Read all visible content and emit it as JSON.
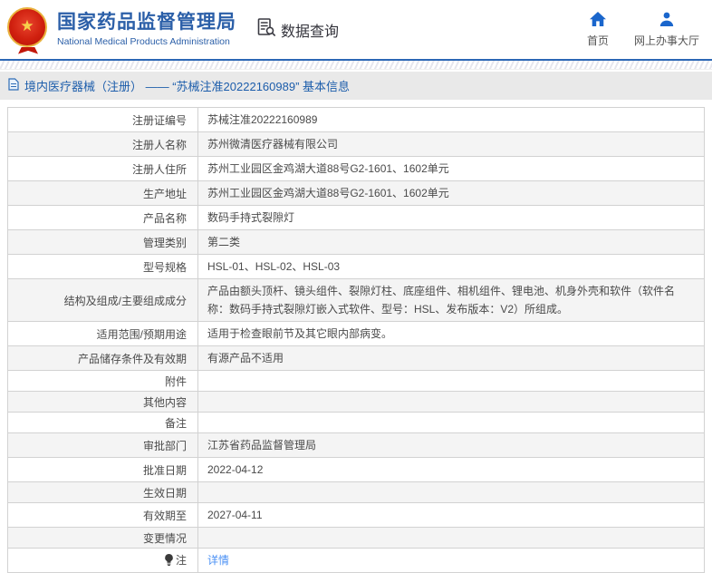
{
  "header": {
    "org_name_zh": "国家药品监督管理局",
    "org_name_en": "National Medical Products Administration",
    "section_title": "数据查询",
    "nav": [
      {
        "label": "首页",
        "icon": "home-icon"
      },
      {
        "label": "网上办事大厅",
        "icon": "user-icon"
      }
    ]
  },
  "breadcrumb": {
    "text": "境内医疗器械（注册） —— “苏械注准20222160989” 基本信息"
  },
  "detail_table": {
    "rows": [
      {
        "label": "注册证编号",
        "value": "苏械注准20222160989"
      },
      {
        "label": "注册人名称",
        "value": "苏州微清医疗器械有限公司"
      },
      {
        "label": "注册人住所",
        "value": "苏州工业园区金鸡湖大道88号G2-1601、1602单元"
      },
      {
        "label": "生产地址",
        "value": "苏州工业园区金鸡湖大道88号G2-1601、1602单元"
      },
      {
        "label": "产品名称",
        "value": "数码手持式裂隙灯"
      },
      {
        "label": "管理类别",
        "value": "第二类"
      },
      {
        "label": "型号规格",
        "value": "HSL-01、HSL-02、HSL-03"
      },
      {
        "label": "结构及组成/主要组成成分",
        "value": "产品由额头顶杆、镜头组件、裂隙灯柱、底座组件、相机组件、锂电池、机身外壳和软件（软件名称：数码手持式裂隙灯嵌入式软件、型号：HSL、发布版本：V2）所组成。"
      },
      {
        "label": "适用范围/预期用途",
        "value": "适用于检查眼前节及其它眼内部病变。"
      },
      {
        "label": "产品储存条件及有效期",
        "value": "有源产品不适用"
      },
      {
        "label": "附件",
        "value": ""
      },
      {
        "label": "其他内容",
        "value": ""
      },
      {
        "label": "备注",
        "value": ""
      },
      {
        "label": "审批部门",
        "value": "江苏省药品监督管理局"
      },
      {
        "label": "批准日期",
        "value": "2022-04-12"
      },
      {
        "label": "生效日期",
        "value": ""
      },
      {
        "label": "有效期至",
        "value": "2027-04-11"
      },
      {
        "label": "变更情况",
        "value": ""
      },
      {
        "label": "注",
        "value": "详情",
        "label_icon": "bulb-icon",
        "link": true
      }
    ]
  },
  "colors": {
    "brand_blue": "#2b5fa8",
    "nav_icon_blue": "#1a66cc",
    "divider_blue": "#2c67b5",
    "breadcrumb_text": "#1c5dab",
    "breadcrumb_bg": "#e9e9e9",
    "row_alt_bg": "#f4f4f4",
    "table_border": "#d2d2d2",
    "link_blue": "#4a90f4",
    "emblem_red": "#c2170b",
    "emblem_gold": "#e9b13c"
  }
}
